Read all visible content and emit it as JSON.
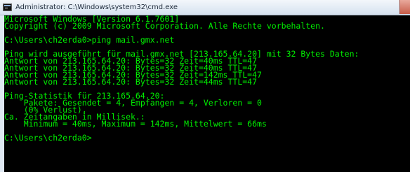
{
  "window": {
    "title": "Administrator: C:\\Windows\\system32\\cmd.exe",
    "icon": "cmd-console-icon"
  },
  "console": {
    "text_color": "#00f000",
    "background": "#000000",
    "lines": [
      "Microsoft Windows [Version 6.1.7601]",
      "Copyright (c) 2009 Microsoft Corporation. Alle Rechte vorbehalten.",
      "C:\\Users\\ch2erda0>ping mail.gmx.net",
      "Ping wird ausgeführt für mail.gmx.net [213.165.64.20] mit 32 Bytes Daten:",
      "Antwort von 213.165.64.20: Bytes=32 Zeit=40ms TTL=47",
      "Antwort von 213.165.64.20: Bytes=32 Zeit=40ms TTL=47",
      "Antwort von 213.165.64.20: Bytes=32 Zeit=142ms TTL=47",
      "Antwort von 213.165.64.20: Bytes=32 Zeit=44ms TTL=47",
      "Ping-Statistik für 213.165.64.20:",
      "    Pakete: Gesendet = 4, Empfangen = 4, Verloren = 0",
      "    (0% Verlust),",
      "Ca. Zeitangaben in Millisek.:",
      "    Minimum = 40ms, Maximum = 142ms, Mittelwert = 66ms",
      "C:\\Users\\ch2erda0>"
    ]
  }
}
